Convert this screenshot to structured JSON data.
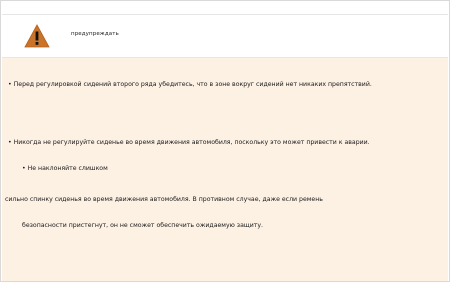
{
  "warning": {
    "icon": "warning-triangle-icon",
    "title": "предупреждать",
    "colors": {
      "header_bg": "#ffffff",
      "body_bg": "#fdf1e4",
      "icon_fill": "#c9742a",
      "icon_mark": "#111111"
    },
    "lines": [
      "• Перед регулировкой сидений второго ряда убедитесь, что в зоне вокруг сидений нет никаких препятствий.",
      "• Никогда не регулируйте сиденье во время движения автомобиля, поскольку это может привести к аварии.",
      "• Не наклоняйте слишком",
      "сильно спинку сиденья во время движения автомобиля. В противном случае, даже если ремень",
      "безопасности пристегнут, он не сможет обеспечить ожидаемую защиту."
    ]
  }
}
